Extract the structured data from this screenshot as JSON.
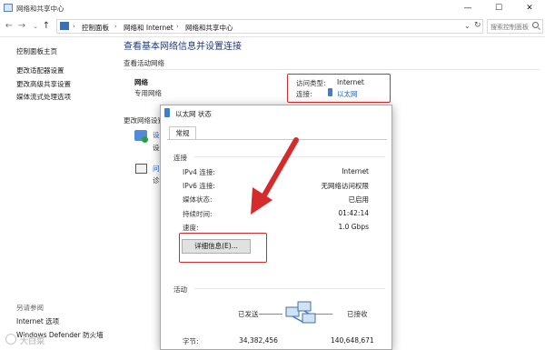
{
  "window": {
    "title": "网络和共享中心",
    "controls": {
      "minimize": "—",
      "maximize": "☐",
      "close": "✕"
    }
  },
  "address_bar": {
    "crumbs": [
      "控制面板",
      "网络和 Internet",
      "网络和共享中心"
    ],
    "search_placeholder": "搜索控制面板"
  },
  "sidebar": {
    "links": [
      "控制面板主页",
      "更改适配器设置",
      "更改高级共享设置",
      "媒体流式处理选项"
    ],
    "see_also_heading": "另请参阅",
    "see_also": [
      "Internet 选项",
      "Windows Defender 防火墙"
    ]
  },
  "main": {
    "title": "查看基本网络信息并设置连接",
    "active_networks_heading": "查看活动网络",
    "network_name": "网络",
    "network_type": "专用网络",
    "access_type_label": "访问类型:",
    "access_type_value": "Internet",
    "connections_label": "连接:",
    "connection_value": "以太网",
    "change_settings_heading": "更改网络设置",
    "item1_fragment_1": "设",
    "item1_fragment_2": "设",
    "item2_fragment_1": "问",
    "item2_fragment_2": "诊"
  },
  "dialog": {
    "title": "以太网 状态",
    "tab": "常规",
    "connection_heading": "连接",
    "rows": [
      {
        "label": "IPv4 连接:",
        "value": "Internet"
      },
      {
        "label": "IPv6 连接:",
        "value": "无网络访问权限"
      },
      {
        "label": "媒体状态:",
        "value": "已启用"
      },
      {
        "label": "持续时间:",
        "value": "01:42:14"
      },
      {
        "label": "速度:",
        "value": "1.0 Gbps"
      }
    ],
    "details_button": "详细信息(E)...",
    "activity_heading": "活动",
    "sent_label": "已发送",
    "received_label": "已接收",
    "bytes_label": "字节:",
    "bytes_sent": "34,382,456",
    "bytes_received": "140,648,671"
  },
  "colors": {
    "annotation_red": "#d52b2b",
    "link_blue": "#1f5fbf",
    "title_blue": "#1e3a78"
  },
  "watermark": "大白菜"
}
